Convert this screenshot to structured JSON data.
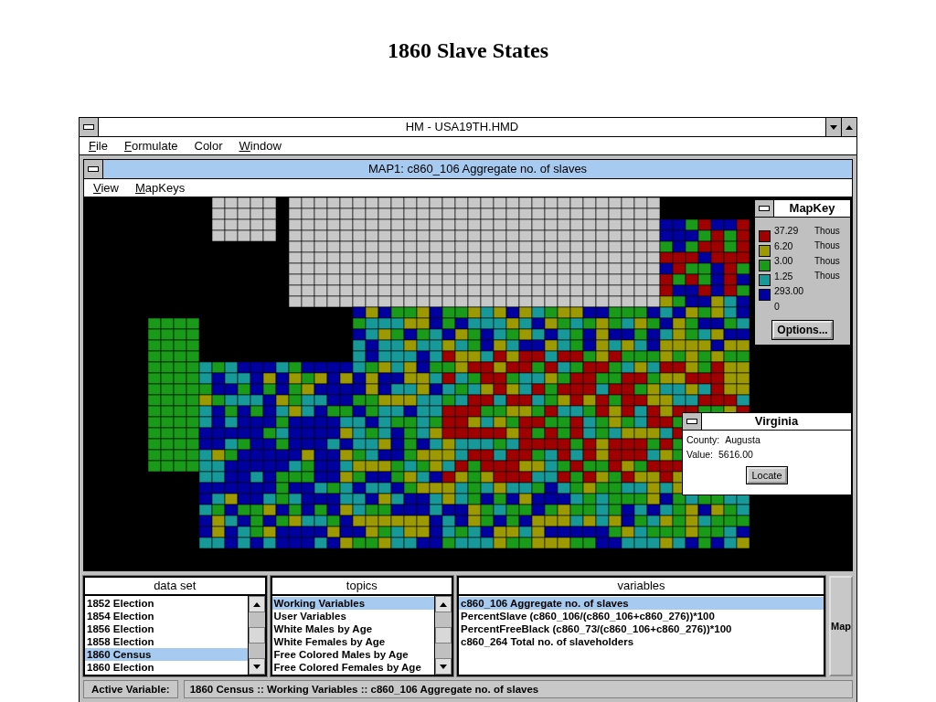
{
  "slide_title": "1860 Slave States",
  "window": {
    "title": "HM - USA19TH.HMD",
    "menu": [
      {
        "label": "File",
        "underline": true
      },
      {
        "label": "Formulate",
        "underline": true
      },
      {
        "label": "Color",
        "underline": false
      },
      {
        "label": "Window",
        "underline": true
      }
    ]
  },
  "map_window": {
    "title": "MAP1: c860_106 Aggregate no. of slaves",
    "menu": [
      {
        "label": "View",
        "underline": true
      },
      {
        "label": "MapKeys",
        "underline": true
      }
    ]
  },
  "map_key": {
    "title": "MapKey",
    "breaks": [
      {
        "value": "37.29",
        "unit": "Thous"
      },
      {
        "value": "6.20",
        "unit": "Thous"
      },
      {
        "value": "3.00",
        "unit": "Thous"
      },
      {
        "value": "1.25",
        "unit": "Thous"
      },
      {
        "value": "293.00"
      },
      {
        "value": "0"
      }
    ],
    "classes": [
      {
        "color": "#a00000"
      },
      {
        "color": "#9c9a00"
      },
      {
        "color": "#199a19"
      },
      {
        "color": "#17999a"
      },
      {
        "color": "#0000a0"
      }
    ],
    "options_button": "Options..."
  },
  "info_popup": {
    "title": "Virginia",
    "county_label": "County:",
    "county": "Augusta",
    "value_label": "Value:",
    "value": "5616.00",
    "locate_button": "Locate"
  },
  "data_set": {
    "heading": "data set",
    "items": [
      {
        "label": "1852 Election",
        "selected": false
      },
      {
        "label": "1854 Election",
        "selected": false
      },
      {
        "label": "1856 Election",
        "selected": false
      },
      {
        "label": "1858 Election",
        "selected": false
      },
      {
        "label": "1860 Census",
        "selected": true
      },
      {
        "label": "1860 Election",
        "selected": false
      }
    ]
  },
  "topics": {
    "heading": "topics",
    "items": [
      {
        "label": "Working Variables",
        "selected": true
      },
      {
        "label": "User Variables",
        "selected": false
      },
      {
        "label": "White Males by Age",
        "selected": false
      },
      {
        "label": "White Females by Age",
        "selected": false
      },
      {
        "label": "Free Colored Males by Age",
        "selected": false
      },
      {
        "label": "Free Colored Females by Age",
        "selected": false
      }
    ]
  },
  "variables": {
    "heading": "variables",
    "items": [
      {
        "label": "c860_106 Aggregate no. of slaves",
        "selected": true
      },
      {
        "label": "PercentSlave (c860_106/(c860_106+c860_276))*100",
        "selected": false
      },
      {
        "label": "PercentFreeBlack (c860_73/(c860_106+c860_276))*100",
        "selected": false
      },
      {
        "label": "c860_264 Total no. of slaveholders",
        "selected": false
      }
    ]
  },
  "map_button": "Map",
  "status_bar": {
    "label": "Active Variable:",
    "value": "1860 Census :: Working Variables :: c860_106 Aggregate no. of slaves"
  }
}
